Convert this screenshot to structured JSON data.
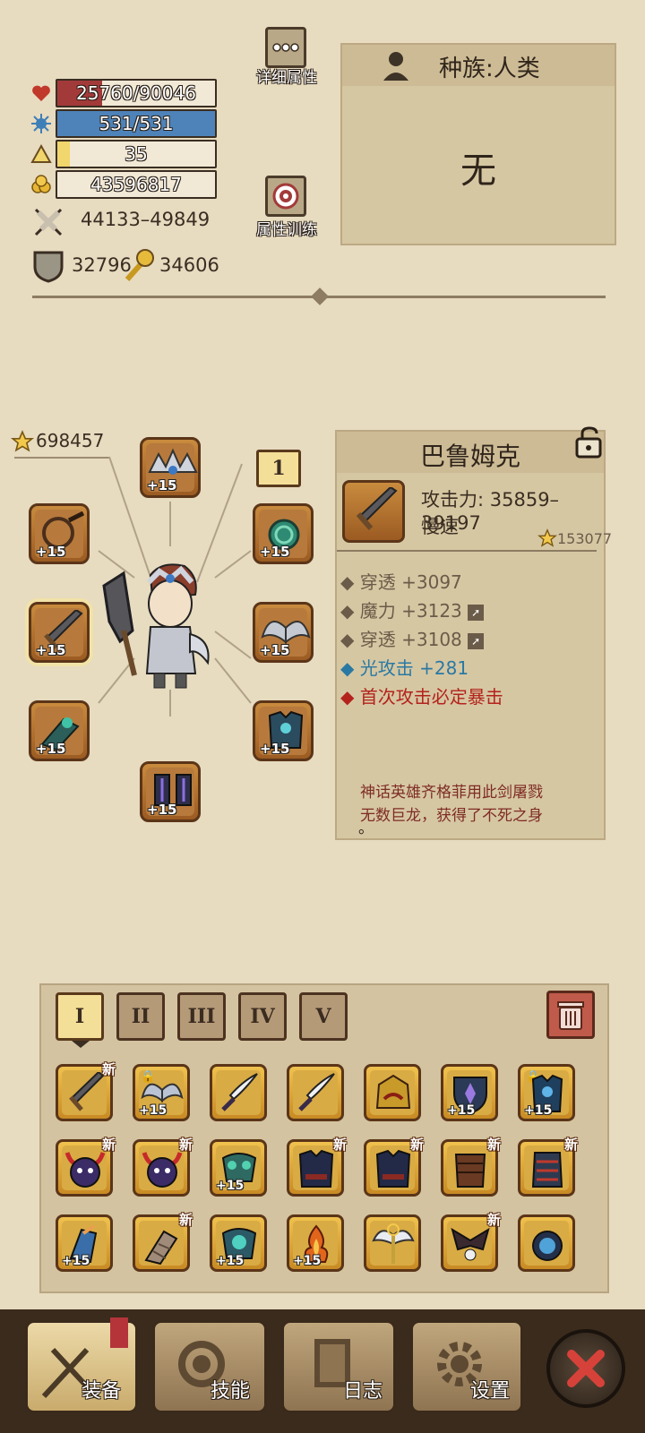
{
  "stats": {
    "hp": "25760/90046",
    "hp_fraction": 0.286,
    "mp": "531/531",
    "level": "35",
    "gold": "43596817",
    "attack": "44133–49849",
    "defense": "32796",
    "magic_defense": "34606"
  },
  "buttons": {
    "details": "详细属性",
    "training": "属性训练"
  },
  "race": {
    "label": "种族:人类",
    "value": "无"
  },
  "equipment": {
    "score": "698457",
    "slot_badge": "1",
    "plus": "+15"
  },
  "item": {
    "name": "巴鲁姆克",
    "attack": "攻击力: 35859–39197",
    "speed": "慢速",
    "score": "153077",
    "attrs": [
      {
        "text": "穿透 +3097",
        "color": "#6b5b49"
      },
      {
        "text": "魔力 +3123",
        "color": "#6b5b49"
      },
      {
        "text": "穿透 +3108",
        "color": "#6b5b49"
      },
      {
        "text": "光攻击 +281",
        "color": "#2a79a3"
      },
      {
        "text": "首次攻击必定暴击",
        "color": "#b3231c"
      }
    ],
    "lore_line1": "神话英雄齐格菲用此剑屠戮",
    "lore_line2": "无数巨龙，获得了不死之身",
    "lore_line3": "。"
  },
  "inventory": {
    "tabs": [
      "I",
      "II",
      "III",
      "IV",
      "V"
    ],
    "new_label": "新",
    "plus_label": "+15"
  },
  "nav": {
    "equip": "装备",
    "skills": "技能",
    "log": "日志",
    "settings": "设置"
  },
  "colors": {
    "hp": "#a33a3a",
    "mp": "#4d83b9",
    "level": "#f0d66c",
    "gold": "#f1e9d6",
    "panel": "#d6c7a3"
  }
}
